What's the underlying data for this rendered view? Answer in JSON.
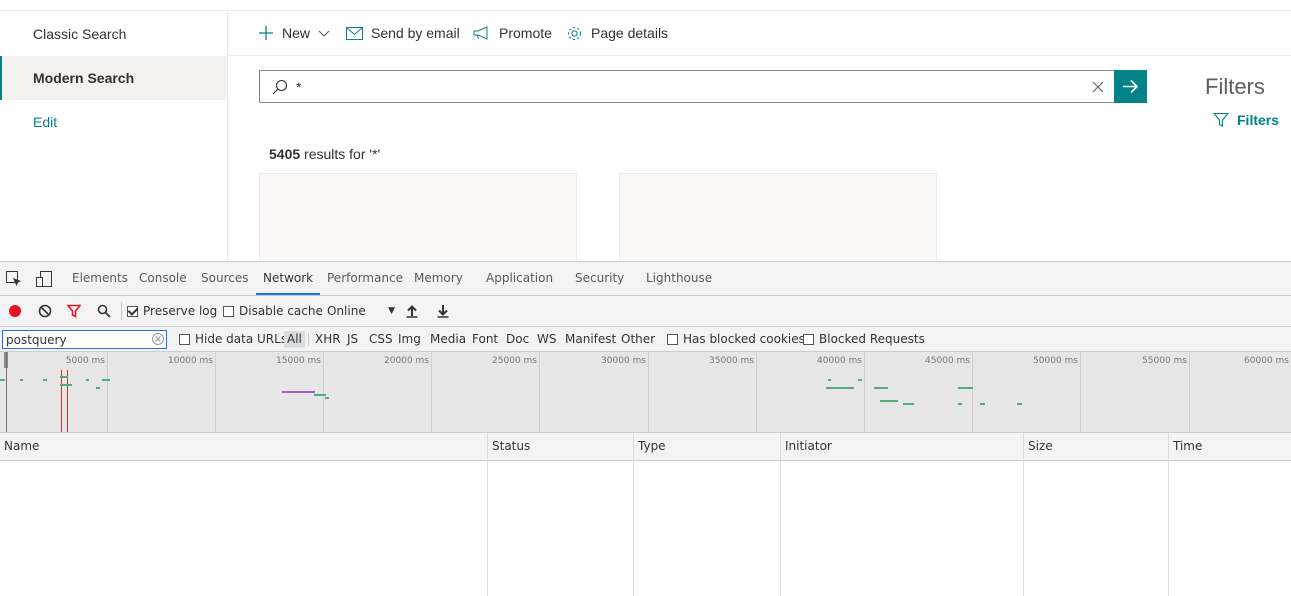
{
  "left_nav": {
    "items": [
      "Classic Search",
      "Modern Search",
      "Edit"
    ]
  },
  "command_bar": {
    "new_label": "New",
    "email_label": "Send by email",
    "promote_label": "Promote",
    "details_label": "Page details"
  },
  "search": {
    "value": "*"
  },
  "filters": {
    "title": "Filters",
    "link_label": "Filters"
  },
  "results": {
    "count": "5405",
    "suffix": " results for '*'"
  },
  "devtools": {
    "tabs": [
      "Elements",
      "Console",
      "Sources",
      "Network",
      "Performance",
      "Memory",
      "Application",
      "Security",
      "Lighthouse"
    ],
    "active_tab": "Network",
    "toolbar": {
      "preserve_log": "Preserve log",
      "disable_cache": "Disable cache",
      "throttle": "Online"
    },
    "filter": {
      "value": "postquery",
      "hide_data_urls": "Hide data URLs",
      "types": [
        "All",
        "XHR",
        "JS",
        "CSS",
        "Img",
        "Media",
        "Font",
        "Doc",
        "WS",
        "Manifest",
        "Other"
      ],
      "has_blocked_cookies": "Has blocked cookies",
      "blocked_requests": "Blocked Requests"
    },
    "timeline_ticks": [
      "5000 ms",
      "10000 ms",
      "15000 ms",
      "20000 ms",
      "25000 ms",
      "30000 ms",
      "35000 ms",
      "40000 ms",
      "45000 ms",
      "50000 ms",
      "55000 ms",
      "60000 ms"
    ],
    "columns": [
      "Name",
      "Status",
      "Type",
      "Initiator",
      "Size",
      "Time"
    ]
  },
  "colors": {
    "accent": "#038387",
    "devtools_blue": "#1a73e8",
    "record_red": "#e81123"
  }
}
